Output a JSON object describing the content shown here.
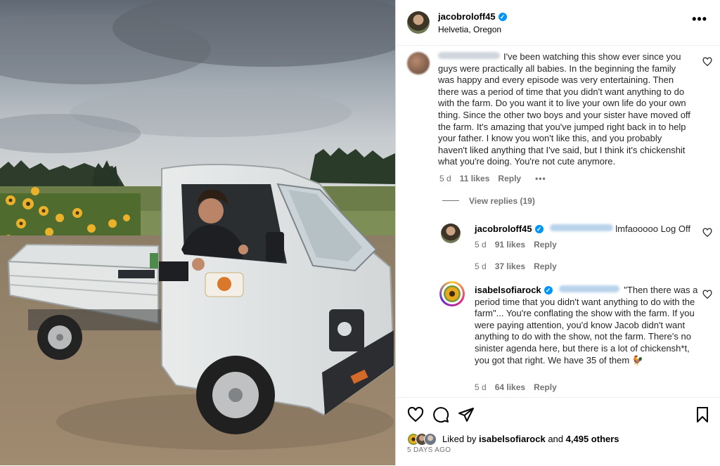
{
  "post": {
    "username": "jacobroloff45",
    "location": "Helvetia, Oregon",
    "more_label": "•••"
  },
  "comments": [
    {
      "text": "I've been watching this show ever since you guys were practically all babies. In the beginning the family was happy and every episode was very entertaining. Then there was a period of time that you didn't want anything to do with the farm. Do you want it to live your own life do your own thing. Since the other two boys and your sister have moved off the farm. It's amazing that you've jumped right back in to help your father. I know you won't like this, and you probably haven't liked anything that I've said, but I think it's chickenshit what you're doing. You're not cute anymore.",
      "age": "5 d",
      "likes": "11 likes",
      "reply": "Reply",
      "options": "•••",
      "view_replies": "View replies (19)"
    },
    {
      "username": "jacobroloff45",
      "text": "lmfaooooo Log Off",
      "age": "5 d",
      "likes": "91 likes",
      "reply": "Reply"
    },
    {
      "age": "5 d",
      "likes": "37 likes",
      "reply": "Reply"
    },
    {
      "username": "isabelsofiarock",
      "text": "\"Then there was a period time that you didn't want anything to do with the farm\"... You're conflating the show with the farm. If you were paying attention, you'd know Jacob didn't want anything to do with the show, not the farm. There's no sinister agenda here, but there is a lot of chickensh*t, you got that right. We have 35 of them 🐓",
      "age": "5 d",
      "likes": "64 likes",
      "reply": "Reply"
    }
  ],
  "footer": {
    "liked_prefix": "Liked by",
    "liked_user": "isabelsofiarock",
    "liked_and": "and",
    "liked_others": "4,495 others",
    "date": "5 DAYS AGO"
  },
  "icons": {
    "like": "heart-icon",
    "comment": "comment-icon",
    "share": "share-icon",
    "save": "bookmark-icon",
    "verified": "verified-badge-icon"
  },
  "colors": {
    "accent": "#0095f6",
    "muted": "#737373",
    "border": "#dbdbdb"
  }
}
